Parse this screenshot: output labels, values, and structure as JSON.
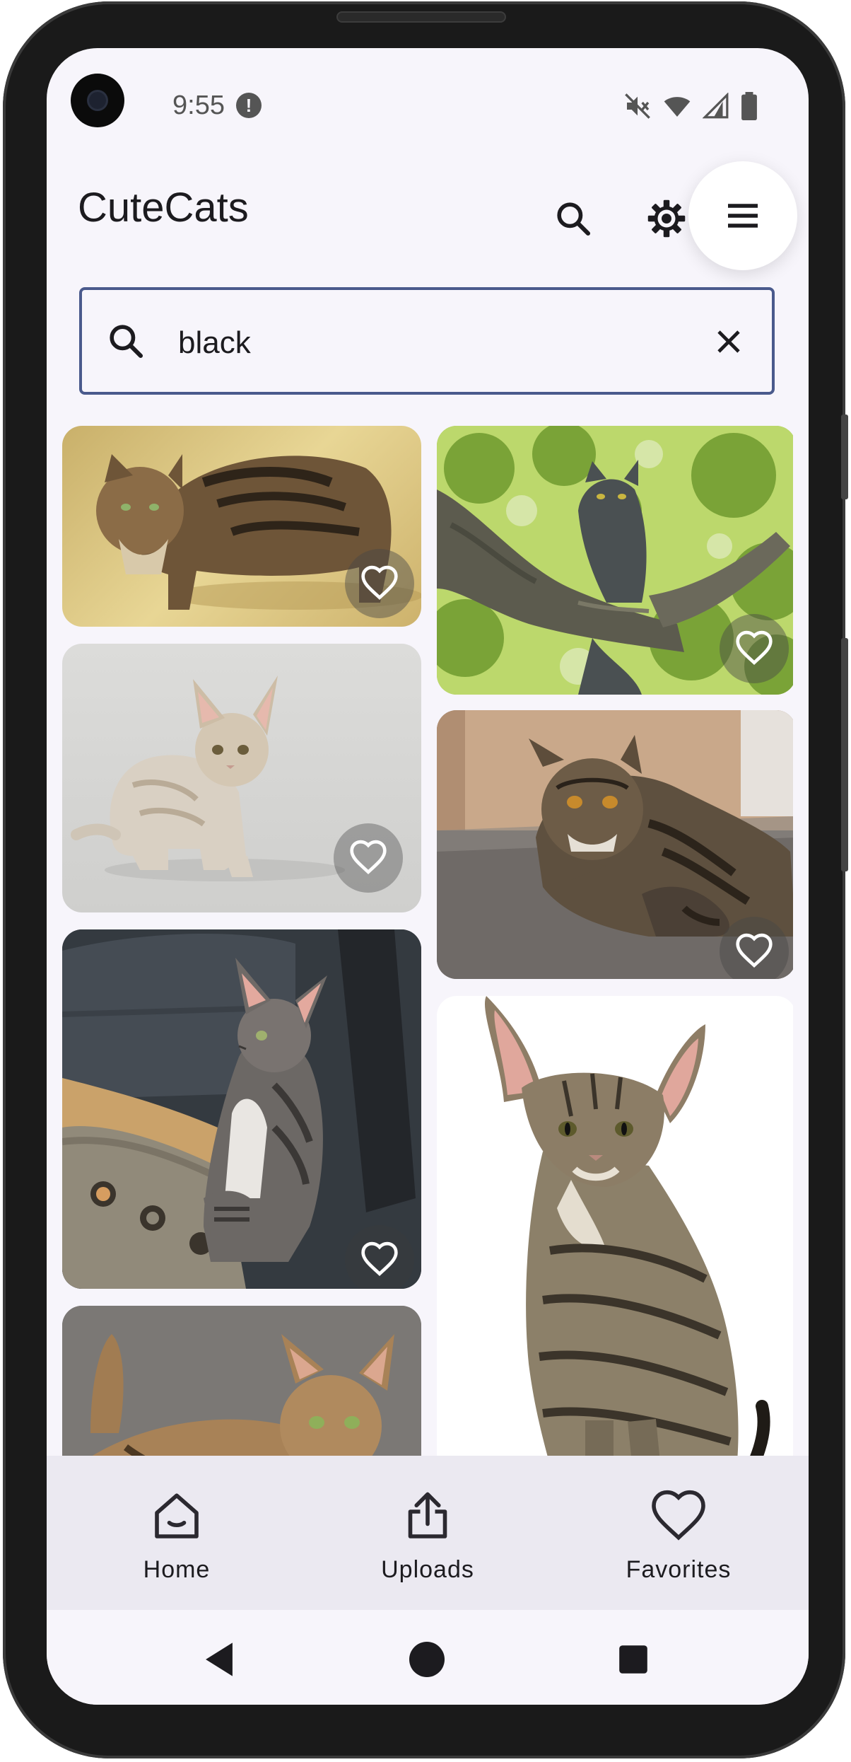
{
  "status_bar": {
    "time": "9:55",
    "alert_icon": "alert-badge-icon",
    "icons": [
      "mute-icon",
      "wifi-icon",
      "signal-icon",
      "battery-icon"
    ]
  },
  "app_bar": {
    "title": "CuteCats",
    "actions": [
      "search-icon",
      "settings-icon",
      "menu-icon"
    ]
  },
  "search": {
    "value": "black",
    "leading_icon": "search-icon",
    "trailing_icon": "clear-icon"
  },
  "colors": {
    "accent_outline": "#4a5a8c",
    "background": "#f7f5fb",
    "nav_background": "#ebe9f1",
    "text": "#1c1b1f"
  },
  "gallery": {
    "items": [
      {
        "subject": "cat-long-haired-tabby",
        "favorite": false
      },
      {
        "subject": "cat-grey-in-tree",
        "favorite": false
      },
      {
        "subject": "cat-curly-kitten",
        "favorite": false
      },
      {
        "subject": "cat-exotic-tabby-floor",
        "favorite": false
      },
      {
        "subject": "cat-tabby-in-car",
        "favorite": false
      },
      {
        "subject": "cat-oriental-tabby",
        "favorite": false
      },
      {
        "subject": "cat-tabby-standing",
        "favorite": false
      }
    ]
  },
  "bottom_nav": {
    "items": [
      {
        "label": "Home",
        "icon": "home-icon"
      },
      {
        "label": "Uploads",
        "icon": "upload-icon"
      },
      {
        "label": "Favorites",
        "icon": "heart-icon"
      }
    ]
  },
  "system_nav": {
    "buttons": [
      "back-icon",
      "home-circle-icon",
      "recents-icon"
    ]
  }
}
